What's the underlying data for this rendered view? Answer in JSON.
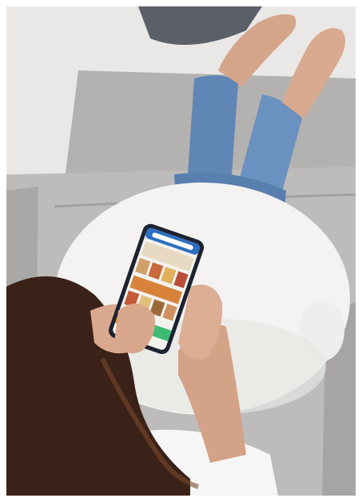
{
  "scene": {
    "description_icon": "photo-icon",
    "colors": {
      "background": "#ffffff",
      "floor": "#e9e8e6",
      "sofa": "#b9b8b7",
      "sofa_dark": "#9e9d9c",
      "cushion": "#f4f3f1",
      "jeans": "#5f86b4",
      "skin": "#d9a88d",
      "hair": "#3a2218",
      "shirt": "#f6f6f6",
      "phone_body": "#1d2230",
      "phone_screen": "#f3f2ee",
      "app_header": "#2b6fc0",
      "app_accent_orange": "#f08a24",
      "app_accent_blue": "#2f84d7",
      "app_accent_green": "#3dbb73"
    }
  }
}
